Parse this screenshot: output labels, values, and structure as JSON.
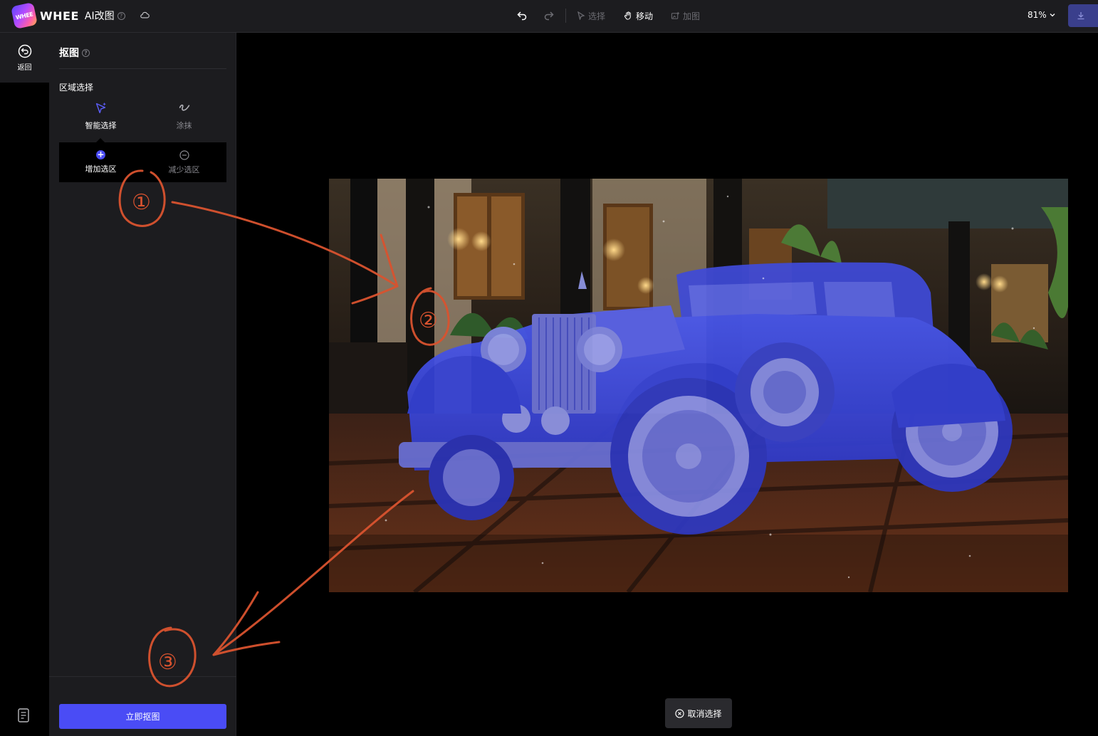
{
  "header": {
    "brand": "WHEE",
    "logo_text": "WHEE",
    "module": "AI改图",
    "tools": {
      "select": "选择",
      "move": "移动",
      "add_image": "加图"
    },
    "zoom": "81%"
  },
  "rail": {
    "back_label": "返回"
  },
  "panel": {
    "title": "抠图",
    "section_label": "区域选择",
    "modes": {
      "smart": "智能选择",
      "brush": "涂抹"
    },
    "sub_modes": {
      "add": "增加选区",
      "remove": "减少选区"
    },
    "primary_button": "立即抠图"
  },
  "canvas": {
    "cancel_selection": "取消选择",
    "annotations": [
      "①",
      "②",
      "③"
    ]
  },
  "colors": {
    "accent": "#4a4cf5",
    "mask": "#4150e6",
    "annotation": "#d9532f",
    "panel_bg": "#1c1c1f"
  }
}
